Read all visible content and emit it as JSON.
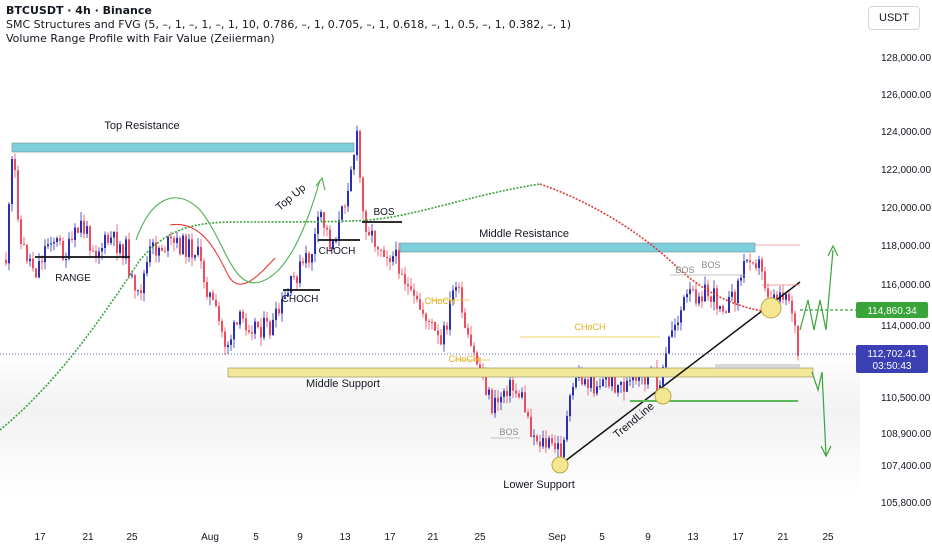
{
  "header": {
    "symbol_line": "BTCUSDT · 4h · Binance",
    "indicator_1": "SMC Structures and FVG (5, –, 1, –, 1, –, 1, 10, 0.786, –, 1, 0.705, –, 1, 0.618, –, 1, 0.5, –, 1, 0.382, –, 1)",
    "indicator_2": "Volume Range Profile with Fair Value (Zeiierman)"
  },
  "unit_button": "USDT",
  "chart_data": {
    "type": "candlestick",
    "y_ticks": [
      "128,000.00",
      "126,000.00",
      "124,000.00",
      "122,000.00",
      "120,000.00",
      "118,000.00",
      "116,000.00",
      "114,000.00",
      "110,500.00",
      "108,900.00",
      "107,400.00",
      "105,800.00"
    ],
    "x_ticks": [
      "17",
      "21",
      "25",
      "Aug",
      "5",
      "9",
      "13",
      "17",
      "21",
      "25",
      "Sep",
      "5",
      "9",
      "13",
      "17",
      "21",
      "25"
    ],
    "price_labels": {
      "green_value": "114,860.34",
      "last_price": "112,702.41",
      "countdown": "03:50:43"
    },
    "annotations": [
      "Top Resistance",
      "RANGE",
      "Top Up",
      "CHOCH",
      "CHOCH",
      "BOS",
      "Middle Resistance",
      "Middle Support",
      "Lower Support",
      "TrendLine",
      "BOS",
      "BOS",
      "BOS",
      "CHoCH",
      "CHoCH",
      "CHoCH"
    ],
    "colors": {
      "up_candle": "#2a2fb8",
      "down_candle": "#ef4c60",
      "resistance_zone": "#7ecfdc",
      "support_zone": "#f3e79a",
      "green_line": "#3aa43a",
      "red_line": "#e23a3a",
      "projection": "#3aa43a"
    }
  }
}
